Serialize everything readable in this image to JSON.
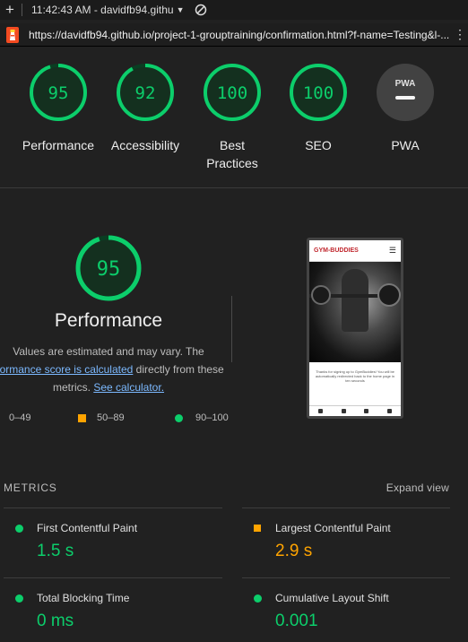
{
  "topbar": {
    "title": "11:42:43 AM - davidfb94.githu",
    "new_tab_icon": "plus-icon",
    "dropdown_icon": "caret-down-icon",
    "no_icon": "prohibited-icon"
  },
  "urlbar": {
    "url": "https://davidfb94.github.io/project-1-grouptraining/confirmation.html?f-name=Testing&l-...",
    "menu_icon": "kebab-icon"
  },
  "gauges": [
    {
      "score": "95",
      "label": "Performance"
    },
    {
      "score": "92",
      "label": "Accessibility"
    },
    {
      "score": "100",
      "label": "Best Practices"
    },
    {
      "score": "100",
      "label": "SEO"
    },
    {
      "badge": "PWA",
      "label": "PWA"
    }
  ],
  "performance": {
    "score": "95",
    "title": "Performance",
    "desc_part1": "Values are estimated and may vary. The",
    "desc_link1": "rformance score is calculated",
    "desc_part2": " directly from these",
    "desc_part3": "metrics. ",
    "desc_link2": "See calculator."
  },
  "legend": {
    "poor": "0–49",
    "average": "50–89",
    "good": "90–100"
  },
  "screenshot": {
    "brand": "GYM-BUDDIES",
    "message": "Thanks for signing up to GymBuddies! You will be automatically redirected back to the home page in ten seconds"
  },
  "metrics": {
    "heading": "METRICS",
    "expand_label": "Expand view",
    "items": [
      {
        "name": "First Contentful Paint",
        "value": "1.5 s"
      },
      {
        "name": "Largest Contentful Paint",
        "value": "2.9 s"
      },
      {
        "name": "Total Blocking Time",
        "value": "0 ms"
      },
      {
        "name": "Cumulative Layout Shift",
        "value": "0.001"
      }
    ]
  },
  "colors": {
    "good": "#0cce6b",
    "average": "#ffa400",
    "poor": "#ff4e42",
    "background": "#212121"
  }
}
